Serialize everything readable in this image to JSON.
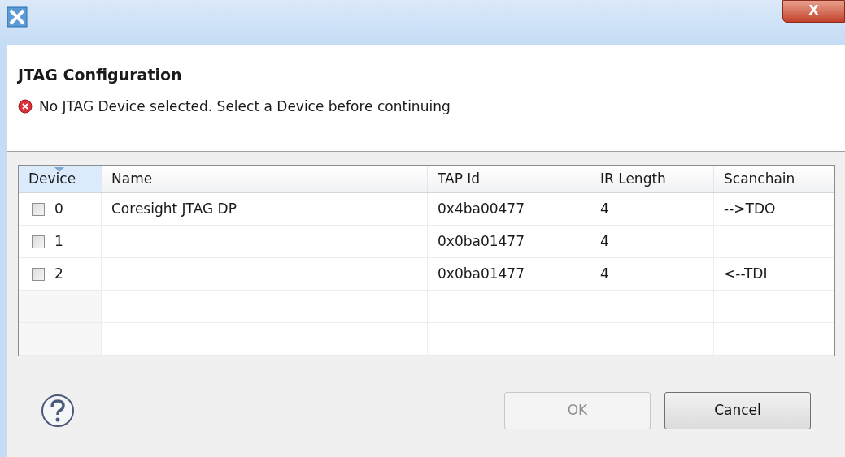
{
  "window": {
    "close_button": "X"
  },
  "header": {
    "title": "JTAG Configuration",
    "message": "No JTAG Device selected. Select a Device before continuing",
    "error": true
  },
  "table": {
    "columns": [
      {
        "label": "Device",
        "sorted": true
      },
      {
        "label": "Name",
        "sorted": false
      },
      {
        "label": "TAP Id",
        "sorted": false
      },
      {
        "label": "IR Length",
        "sorted": false
      },
      {
        "label": "Scanchain",
        "sorted": false
      }
    ],
    "rows": [
      {
        "checked": false,
        "device": "0",
        "name": "Coresight JTAG DP",
        "tap_id": "0x4ba00477",
        "ir_length": "4",
        "scanchain": "-->TDO"
      },
      {
        "checked": false,
        "device": "1",
        "name": "",
        "tap_id": "0x0ba01477",
        "ir_length": "4",
        "scanchain": ""
      },
      {
        "checked": false,
        "device": "2",
        "name": "",
        "tap_id": "0x0ba01477",
        "ir_length": "4",
        "scanchain": "<--TDI"
      }
    ]
  },
  "buttons": [
    {
      "label": "OK",
      "disabled": true
    },
    {
      "label": "Cancel",
      "disabled": false
    }
  ]
}
